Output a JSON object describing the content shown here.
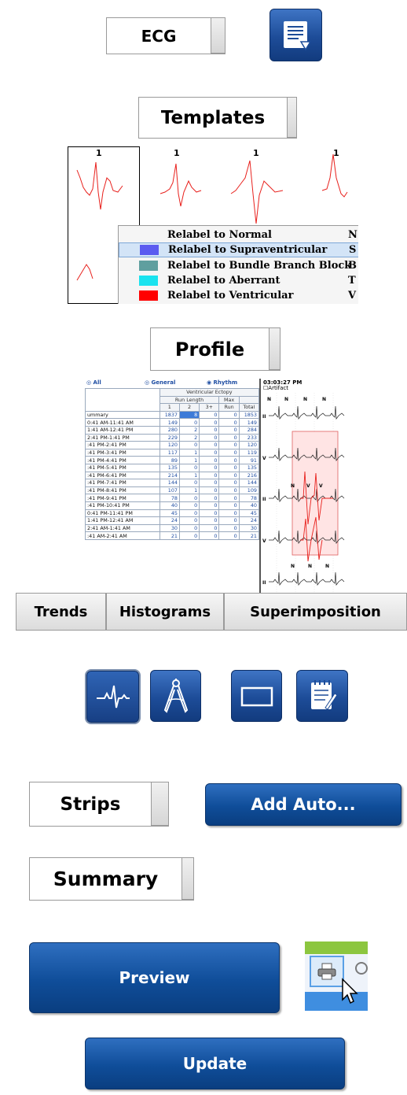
{
  "ecg_tab": {
    "label": "ECG"
  },
  "templates_tab": {
    "label": "Templates"
  },
  "templates_panel": {
    "template_numbers": [
      "1",
      "1",
      "1",
      "1"
    ],
    "context_menu": [
      {
        "label": "Relabel to Normal",
        "shortcut": "N",
        "color": ""
      },
      {
        "label": "Relabel to Supraventricular",
        "shortcut": "S",
        "color": "#5b5bf0"
      },
      {
        "label": "Relabel to Bundle Branch Block",
        "shortcut": "B",
        "color": "#5f9f9f"
      },
      {
        "label": "Relabel to Aberrant",
        "shortcut": "T",
        "color": "#19e3ef"
      },
      {
        "label": "Relabel to Ventricular",
        "shortcut": "V",
        "color": "#ff0000"
      }
    ]
  },
  "profile_tab": {
    "label": "Profile"
  },
  "profile_panel": {
    "filter_all": "All",
    "filter_general": "General",
    "filter_rhythm": "Rhythm",
    "group_header": "Ventricular Ectopy",
    "subheader_run_length": "Run Length",
    "subheader_max": "Max",
    "columns": [
      "1",
      "2",
      "3+",
      "Run",
      "Total"
    ],
    "rows": [
      {
        "label": "ummary",
        "values": [
          "1837",
          "8",
          "0",
          "0",
          "1853"
        ]
      },
      {
        "label": "0:41 AM-11:41 AM",
        "values": [
          "149",
          "0",
          "0",
          "0",
          "149"
        ]
      },
      {
        "label": "1:41 AM-12:41 PM",
        "values": [
          "280",
          "2",
          "0",
          "0",
          "284"
        ]
      },
      {
        "label": "2:41 PM-1:41 PM",
        "values": [
          "229",
          "2",
          "0",
          "0",
          "233"
        ]
      },
      {
        "label": ":41 PM-2:41 PM",
        "values": [
          "120",
          "0",
          "0",
          "0",
          "120"
        ]
      },
      {
        "label": ":41 PM-3:41 PM",
        "values": [
          "117",
          "1",
          "0",
          "0",
          "119"
        ]
      },
      {
        "label": ":41 PM-4:41 PM",
        "values": [
          "89",
          "1",
          "0",
          "0",
          "91"
        ]
      },
      {
        "label": ":41 PM-5:41 PM",
        "values": [
          "135",
          "0",
          "0",
          "0",
          "135"
        ]
      },
      {
        "label": ":41 PM-6:41 PM",
        "values": [
          "214",
          "1",
          "0",
          "0",
          "216"
        ]
      },
      {
        "label": ":41 PM-7:41 PM",
        "values": [
          "144",
          "0",
          "0",
          "0",
          "144"
        ]
      },
      {
        "label": ":41 PM-8:41 PM",
        "values": [
          "107",
          "1",
          "0",
          "0",
          "109"
        ]
      },
      {
        "label": ":41 PM-9:41 PM",
        "values": [
          "78",
          "0",
          "0",
          "0",
          "78"
        ]
      },
      {
        "label": ":41 PM-10:41 PM",
        "values": [
          "40",
          "0",
          "0",
          "0",
          "40"
        ]
      },
      {
        "label": "0:41 PM-11:41 PM",
        "values": [
          "45",
          "0",
          "0",
          "0",
          "45"
        ]
      },
      {
        "label": "1:41 PM-12:41 AM",
        "values": [
          "24",
          "0",
          "0",
          "0",
          "24"
        ]
      },
      {
        "label": "2:41 AM-1:41 AM",
        "values": [
          "30",
          "0",
          "0",
          "0",
          "30"
        ]
      },
      {
        "label": ":41 AM-2:41 AM",
        "values": [
          "21",
          "0",
          "0",
          "0",
          "21"
        ]
      }
    ],
    "strip_time": "03:03:27 PM",
    "artifact_label": "Artifact",
    "lead_labels": [
      "II",
      "V",
      "II",
      "V",
      "II"
    ],
    "beat_labels": [
      "N",
      "N",
      "N",
      "N",
      "N",
      "V",
      "V",
      "N",
      "N",
      "N"
    ]
  },
  "tabs": [
    "Trends",
    "Histograms",
    "Superimposition"
  ],
  "tool_icons": [
    "ecg-waveform-icon",
    "caliper-icon",
    "rectangle-icon",
    "notepad-icon"
  ],
  "strips_tab": {
    "label": "Strips"
  },
  "add_auto_button": {
    "label": "Add Auto..."
  },
  "summary_tab": {
    "label": "Summary"
  },
  "preview_button": {
    "label": "Preview"
  },
  "update_button": {
    "label": "Update"
  },
  "colors": {
    "button_blue": "#0f4d99",
    "icon_blue": "#1d4c98",
    "trace_red": "#e8201c",
    "link_blue": "#1f4ea3",
    "selection_blue": "#3d7bd8",
    "toolbar_green": "#8cc63f"
  }
}
